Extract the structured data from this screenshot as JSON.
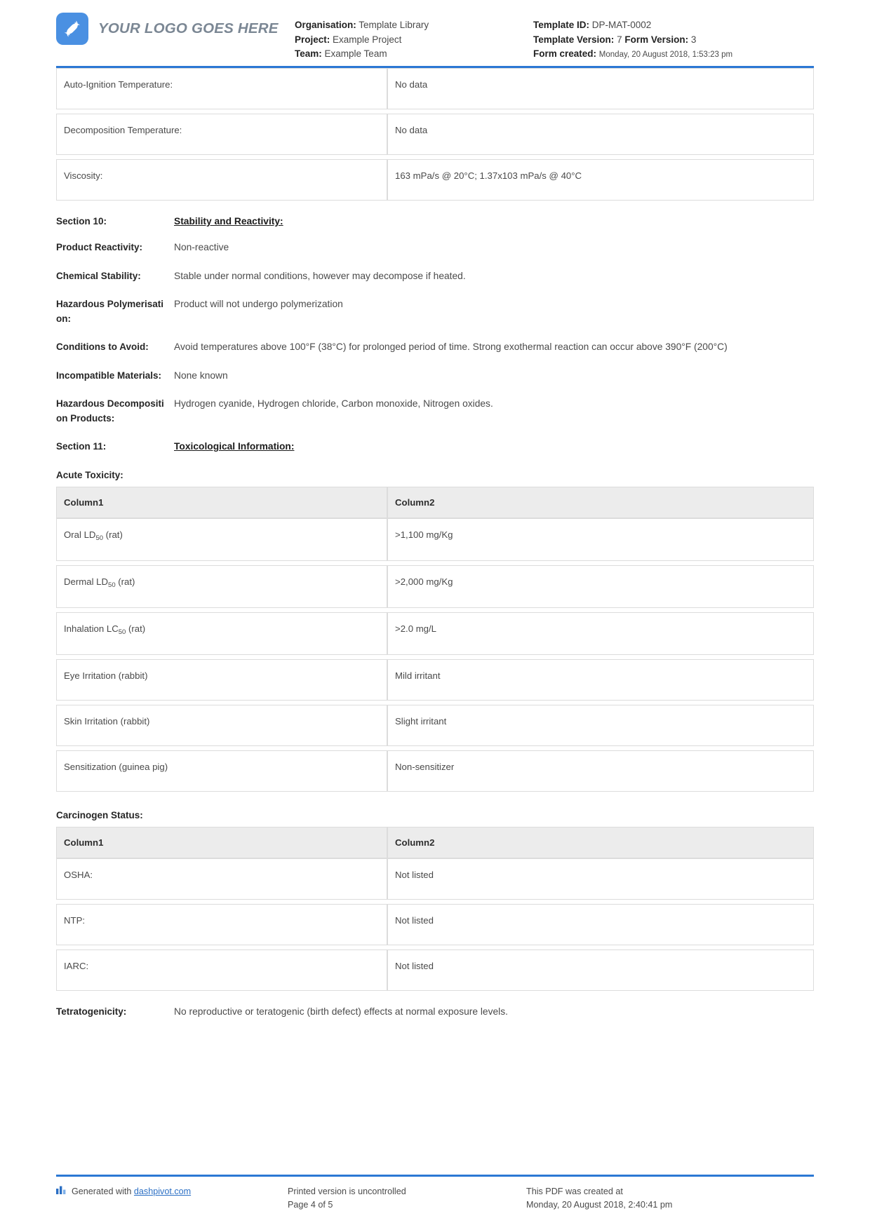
{
  "header": {
    "logo_text": "YOUR LOGO GOES HERE",
    "left": {
      "organisation_label": "Organisation:",
      "organisation_value": "Template Library",
      "project_label": "Project:",
      "project_value": "Example Project",
      "team_label": "Team:",
      "team_value": "Example Team"
    },
    "right": {
      "template_id_label": "Template ID:",
      "template_id_value": "DP-MAT-0002",
      "template_version_label": "Template Version:",
      "template_version_value": "7",
      "form_version_label": "Form Version:",
      "form_version_value": "3",
      "form_created_label": "Form created:",
      "form_created_value": "Monday, 20 August 2018, 1:53:23 pm"
    }
  },
  "properties_table": {
    "rows": [
      {
        "c1": "Auto-Ignition Temperature:",
        "c2": "No data"
      },
      {
        "c1": "Decomposition Temperature:",
        "c2": "No data"
      },
      {
        "c1": "Viscosity:",
        "c2": "163 mPa/s @ 20°C; 1.37x103 mPa/s @ 40°C"
      }
    ]
  },
  "section10": {
    "number": "Section 10:",
    "title": "Stability and Reactivity:",
    "items": [
      {
        "label": "Product Reactivity:",
        "value": "Non-reactive"
      },
      {
        "label": "Chemical Stability:",
        "value": "Stable under normal conditions, however may decompose if heated."
      },
      {
        "label": "Hazardous Polymerisation:",
        "value": "Product will not undergo polymerization"
      },
      {
        "label": "Conditions to Avoid:",
        "value": "Avoid temperatures above 100°F (38°C) for prolonged period of time. Strong exothermal reaction can occur above 390°F (200°C)"
      },
      {
        "label": "Incompatible Materials:",
        "value": "None known"
      },
      {
        "label": "Hazardous Decomposition Products:",
        "value": "Hydrogen cyanide, Hydrogen chloride, Carbon monoxide, Nitrogen oxides."
      }
    ]
  },
  "section11": {
    "number": "Section 11:",
    "title": "Toxicological Information:",
    "acute_toxicity": {
      "heading": "Acute Toxicity:",
      "columns": [
        "Column1",
        "Column2"
      ],
      "rows": [
        {
          "c1_pre": "Oral LD",
          "c1_sub": "50",
          "c1_post": " (rat)",
          "c2": ">1,100 mg/Kg"
        },
        {
          "c1_pre": "Dermal LD",
          "c1_sub": "50",
          "c1_post": " (rat)",
          "c2": ">2,000 mg/Kg"
        },
        {
          "c1_pre": "Inhalation LC",
          "c1_sub": "50",
          "c1_post": " (rat)",
          "c2": ">2.0 mg/L"
        },
        {
          "c1_pre": "Eye Irritation (rabbit)",
          "c1_sub": "",
          "c1_post": "",
          "c2": "Mild irritant"
        },
        {
          "c1_pre": "Skin Irritation (rabbit)",
          "c1_sub": "",
          "c1_post": "",
          "c2": "Slight irritant"
        },
        {
          "c1_pre": "Sensitization (guinea pig)",
          "c1_sub": "",
          "c1_post": "",
          "c2": "Non-sensitizer"
        }
      ]
    },
    "carcinogen_status": {
      "heading": "Carcinogen Status:",
      "columns": [
        "Column1",
        "Column2"
      ],
      "rows": [
        {
          "c1": "OSHA:",
          "c2": "Not listed"
        },
        {
          "c1": "NTP:",
          "c2": "Not listed"
        },
        {
          "c1": "IARC:",
          "c2": "Not listed"
        }
      ]
    },
    "tetratogenicity": {
      "label": "Tetratogenicity:",
      "value": "No reproductive or teratogenic (birth defect) effects at normal exposure levels."
    }
  },
  "footer": {
    "generated_prefix": "Generated with",
    "generated_link": "dashpivot.com",
    "printed_line1": "Printed version is uncontrolled",
    "printed_line2": "Page 4 of 5",
    "created_line1": "This PDF was created at",
    "created_line2": "Monday, 20 August 2018, 2:40:41 pm"
  },
  "colors": {
    "accent_blue": "#2b78d4",
    "logo_blue": "#4a90e2",
    "header_grey": "#ececec"
  }
}
